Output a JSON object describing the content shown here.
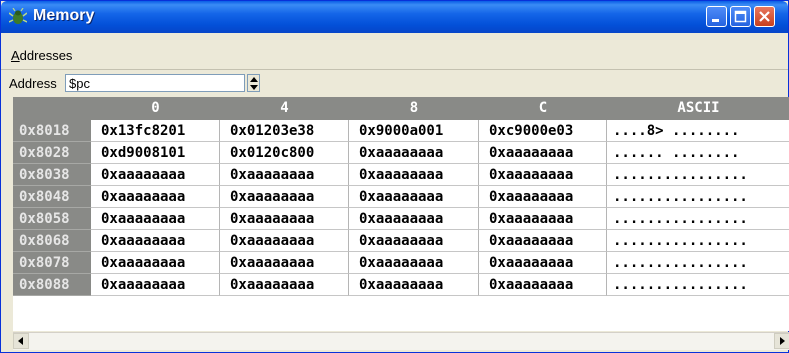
{
  "window": {
    "title": "Memory"
  },
  "menu": {
    "addresses_first": "A",
    "addresses_rest": "ddresses"
  },
  "address_bar": {
    "label": "Address",
    "value": "$pc"
  },
  "grid": {
    "columns": [
      "0",
      "4",
      "8",
      "C",
      "ASCII"
    ],
    "rows": [
      {
        "addr": "0x8018",
        "words": [
          "0x13fc8201",
          "0x01203e38",
          "0x9000a001",
          "0xc9000e03"
        ],
        "ascii": "....8> ........"
      },
      {
        "addr": "0x8028",
        "words": [
          "0xd9008101",
          "0x0120c800",
          "0xaaaaaaaa",
          "0xaaaaaaaa"
        ],
        "ascii": "...... ........"
      },
      {
        "addr": "0x8038",
        "words": [
          "0xaaaaaaaa",
          "0xaaaaaaaa",
          "0xaaaaaaaa",
          "0xaaaaaaaa"
        ],
        "ascii": "................"
      },
      {
        "addr": "0x8048",
        "words": [
          "0xaaaaaaaa",
          "0xaaaaaaaa",
          "0xaaaaaaaa",
          "0xaaaaaaaa"
        ],
        "ascii": "................"
      },
      {
        "addr": "0x8058",
        "words": [
          "0xaaaaaaaa",
          "0xaaaaaaaa",
          "0xaaaaaaaa",
          "0xaaaaaaaa"
        ],
        "ascii": "................"
      },
      {
        "addr": "0x8068",
        "words": [
          "0xaaaaaaaa",
          "0xaaaaaaaa",
          "0xaaaaaaaa",
          "0xaaaaaaaa"
        ],
        "ascii": "................"
      },
      {
        "addr": "0x8078",
        "words": [
          "0xaaaaaaaa",
          "0xaaaaaaaa",
          "0xaaaaaaaa",
          "0xaaaaaaaa"
        ],
        "ascii": "................"
      },
      {
        "addr": "0x8088",
        "words": [
          "0xaaaaaaaa",
          "0xaaaaaaaa",
          "0xaaaaaaaa",
          "0xaaaaaaaa"
        ],
        "ascii": "................"
      }
    ]
  },
  "icons": {
    "app": "bug-icon",
    "minimize": "minimize-icon",
    "maximize": "maximize-icon",
    "close": "close-icon",
    "scroll_left": "arrow-left-icon",
    "scroll_right": "arrow-right-icon"
  },
  "colors": {
    "titlebar": "#0a5ee6",
    "header": "#898a87",
    "background": "#ece9d8"
  }
}
